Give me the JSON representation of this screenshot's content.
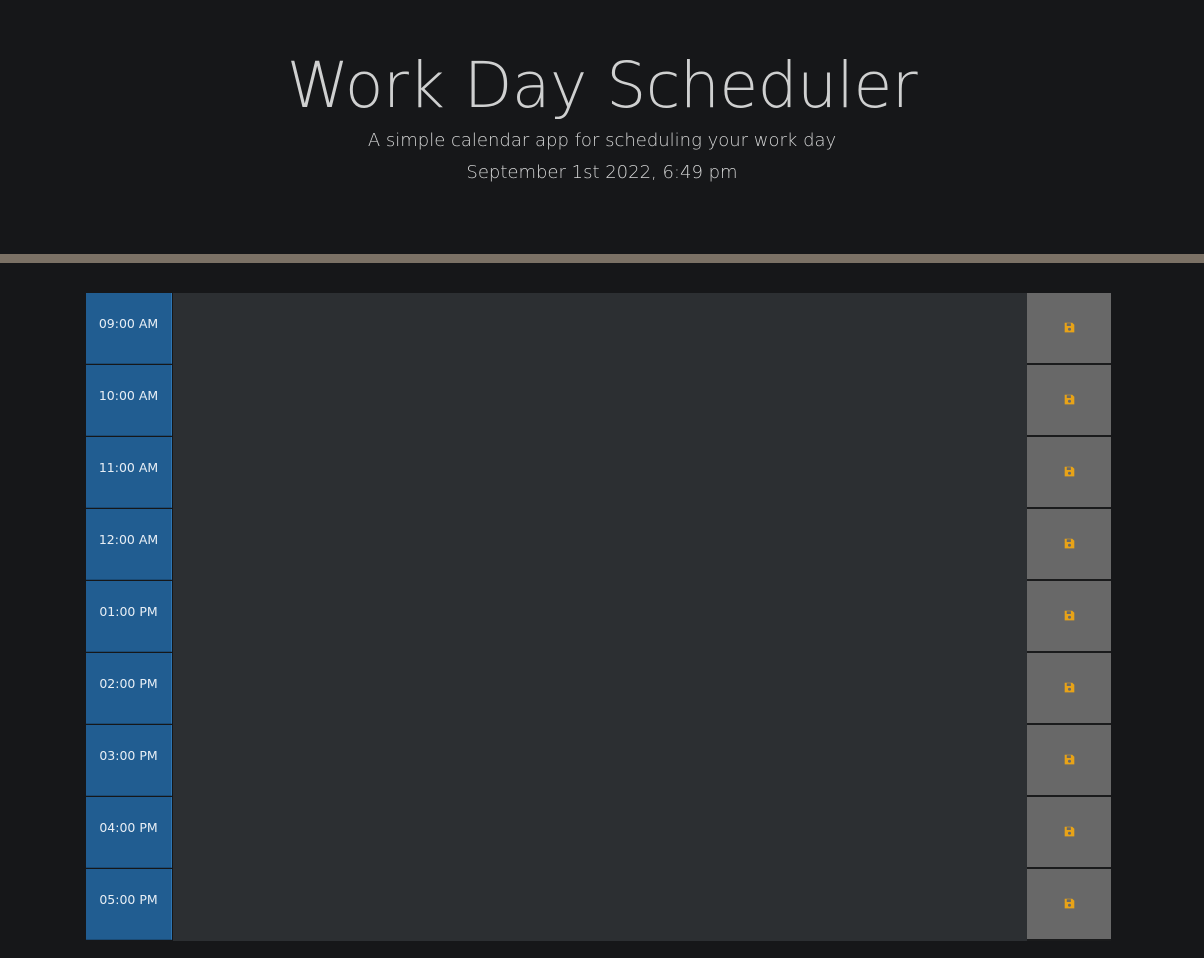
{
  "header": {
    "title": "Work Day Scheduler",
    "subtitle": "A simple calendar app for scheduling your work day",
    "current_datetime": "September 1st 2022, 6:49 pm"
  },
  "colors": {
    "hour_block": "#215d91",
    "description_bg": "#2c2f32",
    "save_button_bg": "#686868",
    "save_icon": "#e8a317",
    "divider": "#7b7165"
  },
  "save_icon_name": "floppy-disk-icon",
  "time_blocks": [
    {
      "hour": "09:00 AM",
      "text": ""
    },
    {
      "hour": "10:00 AM",
      "text": ""
    },
    {
      "hour": "11:00 AM",
      "text": ""
    },
    {
      "hour": "12:00 AM",
      "text": ""
    },
    {
      "hour": "01:00 PM",
      "text": ""
    },
    {
      "hour": "02:00 PM",
      "text": ""
    },
    {
      "hour": "03:00 PM",
      "text": ""
    },
    {
      "hour": "04:00 PM",
      "text": ""
    },
    {
      "hour": "05:00 PM",
      "text": ""
    }
  ]
}
